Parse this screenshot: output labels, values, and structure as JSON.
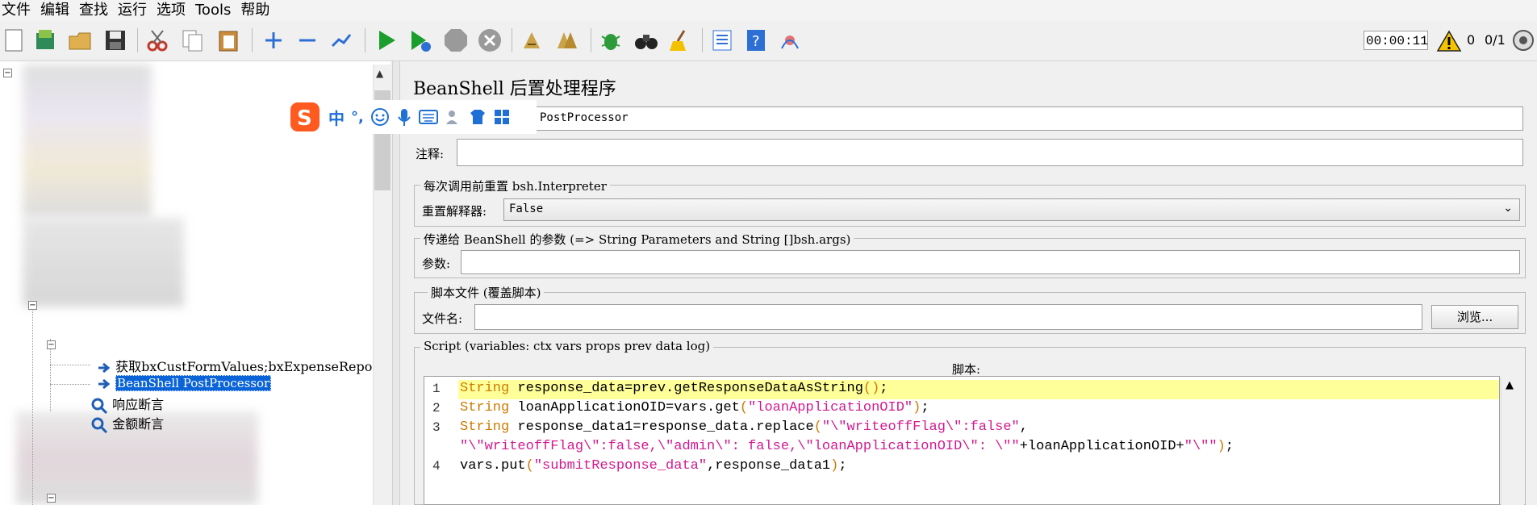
{
  "menu": [
    "文件",
    "编辑",
    "查找",
    "运行",
    "选项",
    "Tools",
    "帮助"
  ],
  "toolbar": {
    "timer": "00:00:11",
    "warning_count": "0",
    "thread_count": "0/1"
  },
  "ime": {
    "lang": "中",
    "punct": "°,"
  },
  "tree": {
    "items": [
      {
        "label": "获取bxCustFormValues;bxExpenseRepor",
        "selected": false
      },
      {
        "label": "BeanShell PostProcessor",
        "selected": true
      },
      {
        "label": "响应断言",
        "selected": false
      },
      {
        "label": "金额断言",
        "selected": false
      }
    ]
  },
  "panel": {
    "title": "BeanShell 后置处理程序",
    "name_value": "PostProcessor",
    "comment_label": "注释:",
    "reset_group": {
      "title": "每次调用前重置 bsh.Interpreter",
      "label": "重置解释器:",
      "value": "False"
    },
    "params_group": {
      "title": "传递给 BeanShell 的参数 (=> String Parameters and String []bsh.args)",
      "label": "参数:"
    },
    "file_group": {
      "title": "脚本文件 (覆盖脚本)",
      "label": "文件名:",
      "browse": "浏览..."
    },
    "script_group": {
      "title": "Script (variables: ctx vars props prev data log)",
      "header": "脚本:"
    }
  },
  "script_lines": [
    "String response_data=prev.getResponseDataAsString();",
    "String loanApplicationOID=vars.get(\"loanApplicationOID\");",
    "String response_data1=response_data.replace(\"\\\"writeoffFlag\\\":false\",",
    "\"\\\"writeoffFlag\\\":false,\\\"admin\\\": false,\\\"loanApplicationOID\\\": \\\"\"+loanApplicationOID+\"\\\"\");",
    "vars.put(\"submitResponse_data\",response_data1);"
  ],
  "line_numbers": [
    "1",
    "2",
    "3",
    "4"
  ],
  "colors": {
    "keyword": "#cc7a00",
    "string": "#d11a8f",
    "highlight": "#ffff99",
    "selection": "#0a64d8"
  }
}
